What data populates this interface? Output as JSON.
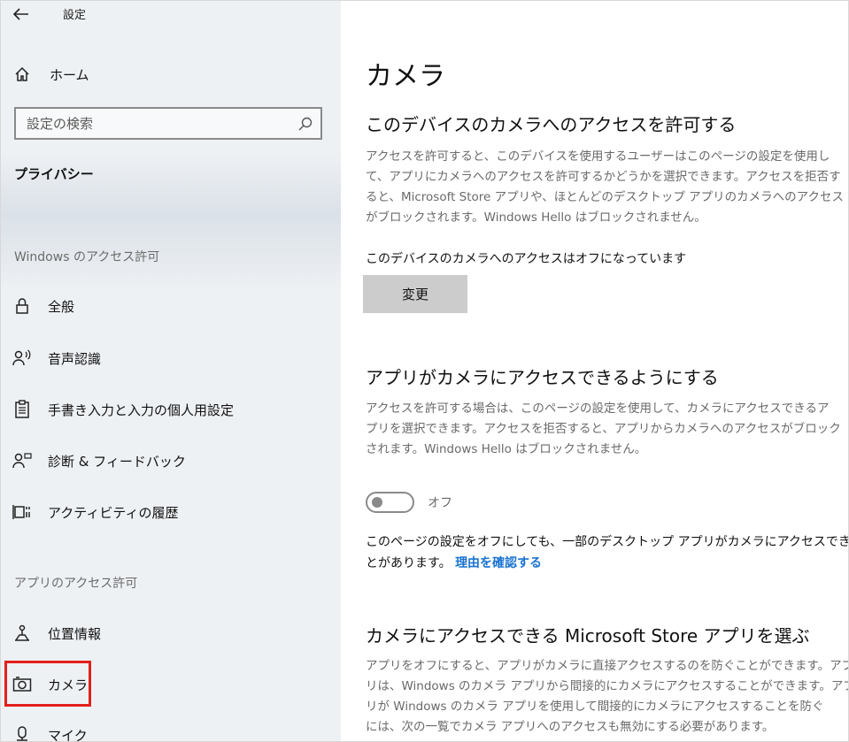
{
  "window": {
    "title": "設定",
    "back_icon": "back-arrow-icon"
  },
  "sidebar": {
    "home_label": "ホーム",
    "search": {
      "placeholder": "設定の検索"
    },
    "section_title": "プライバシー",
    "groups": [
      {
        "title": "Windows のアクセス許可",
        "items": [
          {
            "label": "全般",
            "icon": "lock-icon"
          },
          {
            "label": "音声認識",
            "icon": "speech-icon"
          },
          {
            "label": "手書き入力と入力の個人用設定",
            "icon": "clipboard-icon"
          },
          {
            "label": "診断 & フィードバック",
            "icon": "feedback-person-icon"
          },
          {
            "label": "アクティビティの履歴",
            "icon": "timeline-icon"
          }
        ]
      },
      {
        "title": "アプリのアクセス許可",
        "items": [
          {
            "label": "位置情報",
            "icon": "location-person-icon"
          },
          {
            "label": "カメラ",
            "icon": "camera-icon",
            "selected": true
          },
          {
            "label": "マイク",
            "icon": "microphone-icon"
          }
        ]
      }
    ]
  },
  "main": {
    "title": "カメラ",
    "device_access": {
      "heading": "このデバイスのカメラへのアクセスを許可する",
      "desc_lines": [
        "アクセスを許可すると、このデバイスを使用するユーザーはこのページの設定を使用し",
        "て、アプリにカメラへのアクセスを許可するかどうかを選択できます。アクセスを拒否す",
        "ると、Microsoft Store アプリや、ほとんどのデスクトップ アプリのカメラへのアクセス",
        "がブロックされます。Windows Hello はブロックされません。"
      ],
      "status": "このデバイスのカメラへのアクセスはオフになっています",
      "change_label": "変更"
    },
    "app_access": {
      "heading": "アプリがカメラにアクセスできるようにする",
      "desc_lines": [
        "アクセスを許可する場合は、このページの設定を使用して、カメラにアクセスできるア",
        "プリを選択できます。アクセスを拒否すると、アプリからカメラへのアクセスがブロック",
        "されます。Windows Hello はブロックされません。"
      ],
      "toggle_state": "オフ",
      "toggle_on": false,
      "note_line1": "このページの設定をオフにしても、一部のデスクトップ アプリがカメラにアクセスできるこ",
      "note_line2": "とがあります。",
      "note_link": "理由を確認する"
    },
    "store_apps": {
      "heading": "カメラにアクセスできる Microsoft Store アプリを選ぶ",
      "desc_lines": [
        "アプリをオフにすると、アプリがカメラに直接アクセスするのを防ぐことができます。アプ",
        "リは、Windows のカメラ アプリから間接的にカメラにアクセスすることができます。アプ",
        "リが Windows のカメラ アプリを使用して間接的にカメラにアクセスすることを防ぐ",
        "には、次の一覧でカメラ アプリへのアクセスも無効にする必要があります。"
      ]
    }
  },
  "colors": {
    "link": "#1a73d0",
    "selection_highlight": "#e3201b",
    "sidebar_bg": "#eef1f4",
    "button_bg": "#cccccc"
  }
}
